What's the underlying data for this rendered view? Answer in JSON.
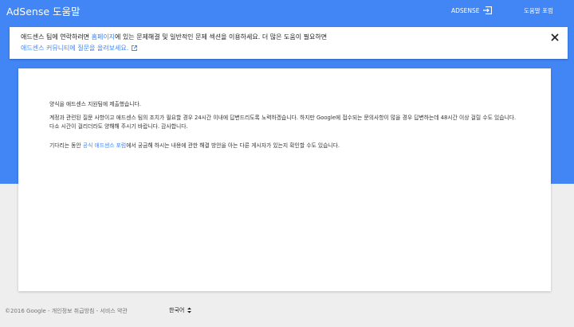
{
  "header": {
    "app_title": "AdSense 도움말",
    "adsense_link": "ADSENSE",
    "forum_link": "도움말 포럼"
  },
  "notice": {
    "line1_before": "애드센스 팀에 연락하려면 ",
    "line1_link": "홈페이지",
    "line1_after": "에 있는 문제해결 및 일반적인 문제 섹션을 이용하세요. 더 많은 도움이 필요하면",
    "line2_link": "애드센스 커뮤니티에 질문을 올려보세요."
  },
  "content": {
    "p1": "양식을 애드센스 지원팀에 제출했습니다.",
    "p2": "계정과 관련된 질문 사항이고 애드센스 팀의 조치가 필요할 경우 24시간 이내에 답변드리도록 노력하겠습니다. 하지만 Google에 접수되는 문의사항이 많을 경우 답변하는데 48시간 이상 걸릴 수도 있습니다. 다소 시간이 걸리더라도 양해해 주시기 바랍니다. 감사합니다.",
    "p3_before": "기다리는 동안 ",
    "p3_link": "공식 애드센스 포럼",
    "p3_after": "에서 궁금해 하시는 내용에 관한 해결 방안을 아는 다른 게시자가 있는지 확인할 수도 있습니다."
  },
  "footer": {
    "copyright": "©2016 Google - 개인정보 취급방침 - 서비스 약관",
    "language": "한국어"
  },
  "colors": {
    "brand_blue": "#4285f4",
    "background": "#eeeeee"
  }
}
